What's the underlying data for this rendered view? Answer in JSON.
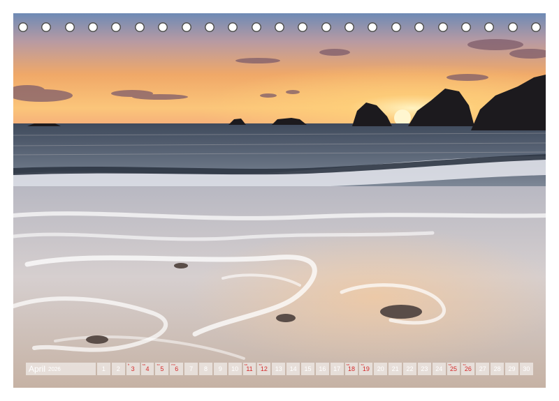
{
  "calendar": {
    "month": "April",
    "year": "2026",
    "days": [
      {
        "day": "1",
        "holiday": false
      },
      {
        "day": "2",
        "holiday": false
      },
      {
        "day": "3",
        "holiday": true,
        "label": "fr"
      },
      {
        "day": "4",
        "holiday": true,
        "label": "sa"
      },
      {
        "day": "5",
        "holiday": true,
        "label": "so"
      },
      {
        "day": "6",
        "holiday": true,
        "label": "mo"
      },
      {
        "day": "7",
        "holiday": false
      },
      {
        "day": "8",
        "holiday": false
      },
      {
        "day": "9",
        "holiday": false
      },
      {
        "day": "10",
        "holiday": false
      },
      {
        "day": "11",
        "holiday": true,
        "label": "sa"
      },
      {
        "day": "12",
        "holiday": true,
        "label": "so"
      },
      {
        "day": "13",
        "holiday": false
      },
      {
        "day": "14",
        "holiday": false
      },
      {
        "day": "15",
        "holiday": false
      },
      {
        "day": "16",
        "holiday": false
      },
      {
        "day": "17",
        "holiday": false
      },
      {
        "day": "18",
        "holiday": true,
        "label": "sa"
      },
      {
        "day": "19",
        "holiday": true,
        "label": "so"
      },
      {
        "day": "20",
        "holiday": false
      },
      {
        "day": "21",
        "holiday": false
      },
      {
        "day": "22",
        "holiday": false
      },
      {
        "day": "23",
        "holiday": false
      },
      {
        "day": "24",
        "holiday": false
      },
      {
        "day": "25",
        "holiday": true,
        "label": "sa"
      },
      {
        "day": "26",
        "holiday": true,
        "label": "so"
      },
      {
        "day": "27",
        "holiday": false
      },
      {
        "day": "28",
        "holiday": false
      },
      {
        "day": "29",
        "holiday": false
      },
      {
        "day": "30",
        "holiday": false
      }
    ]
  },
  "binding": {
    "ring_count": 23
  }
}
